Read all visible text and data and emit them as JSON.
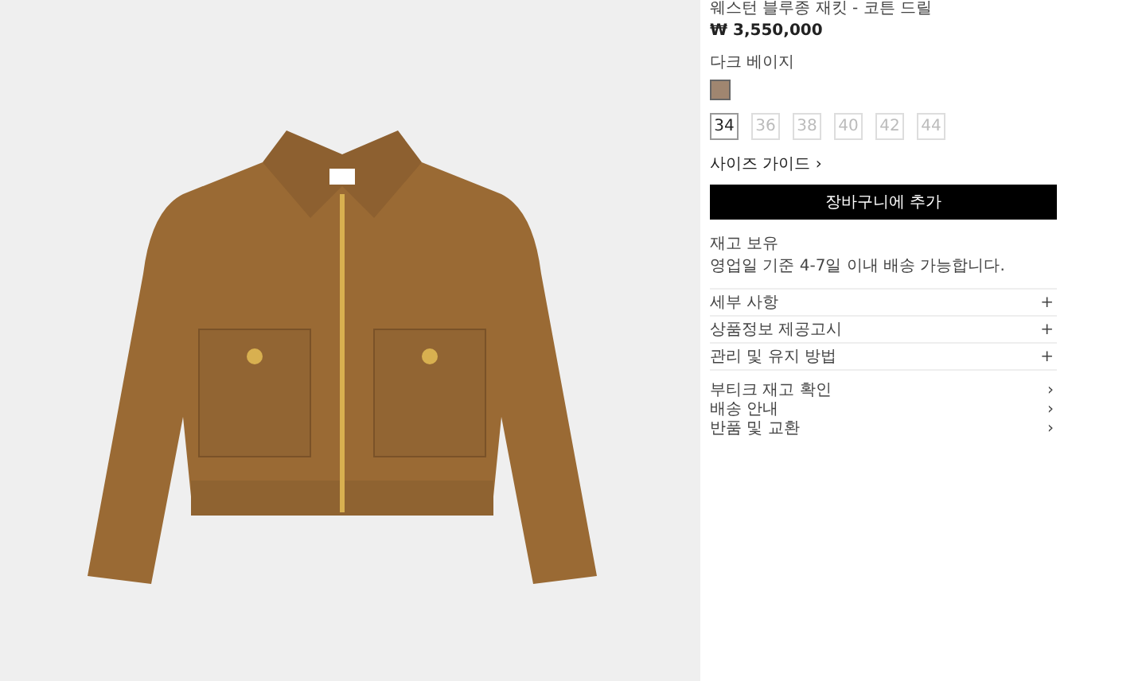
{
  "product": {
    "title": "웨스턴 블루종 재킷 - 코튼 드릴",
    "price": "₩ 3,550,000",
    "color_name": "다크 베이지",
    "swatches": [
      {
        "color": "#a08670"
      }
    ],
    "sizes": [
      {
        "label": "34",
        "selected": true,
        "disabled": false
      },
      {
        "label": "36",
        "selected": false,
        "disabled": true
      },
      {
        "label": "38",
        "selected": false,
        "disabled": true
      },
      {
        "label": "40",
        "selected": false,
        "disabled": true
      },
      {
        "label": "42",
        "selected": false,
        "disabled": true
      },
      {
        "label": "44",
        "selected": false,
        "disabled": true
      }
    ],
    "size_guide": "사이즈 가이드",
    "size_guide_icon": "›",
    "add_to_cart": "장바구니에 추가",
    "stock_status": "재고 보유",
    "delivery_note": "영업일 기준 4-7일 이내 배송 가능합니다.",
    "accordions": [
      {
        "label": "세부 사항",
        "icon": "+"
      },
      {
        "label": "상품정보 제공고시",
        "icon": "+"
      },
      {
        "label": "관리 및 유지 방법",
        "icon": "+"
      }
    ],
    "links": [
      {
        "label": "부티크 재고 확인",
        "icon": "›"
      },
      {
        "label": "배송 안내",
        "icon": "›"
      },
      {
        "label": "반품 및 교환",
        "icon": "›"
      }
    ]
  }
}
